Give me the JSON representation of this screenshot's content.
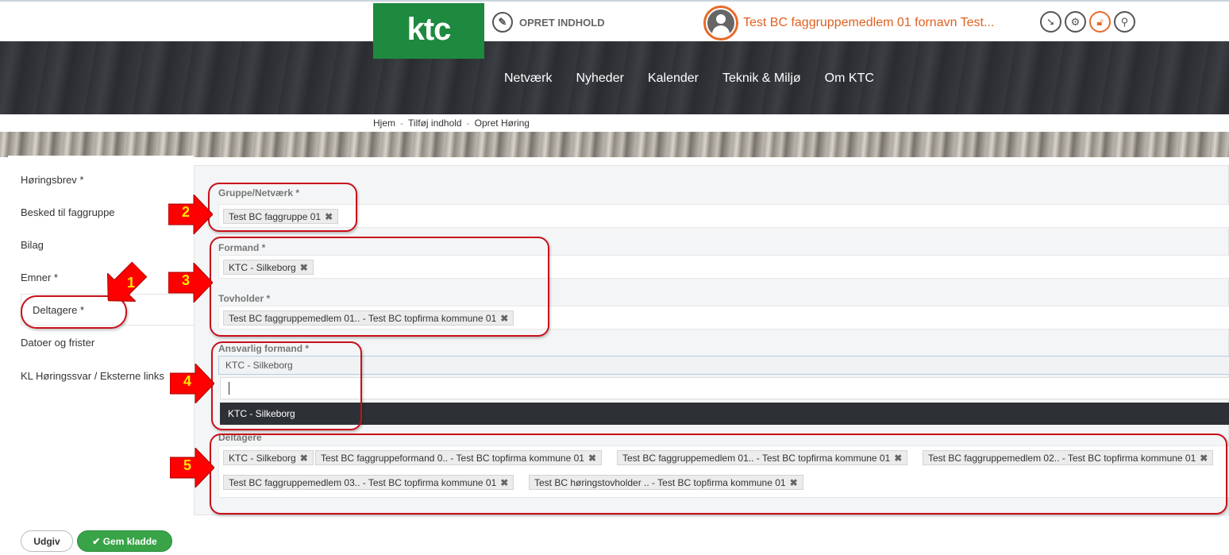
{
  "header": {
    "logo_text": "ktc",
    "create_label": "OPRET INDHOLD",
    "user_name": "Test BC faggruppemedlem 01 fornavn Test...",
    "icons": [
      "download-icon",
      "gear-icon",
      "lock-icon",
      "search-icon"
    ]
  },
  "nav": {
    "items": [
      "Netværk",
      "Nyheder",
      "Kalender",
      "Teknik & Miljø",
      "Om KTC"
    ]
  },
  "breadcrumb": {
    "items": [
      "Hjem",
      "Tilføj indhold",
      "Opret Høring"
    ],
    "separator": "-"
  },
  "sidebar": {
    "items": [
      {
        "label": "Høringsbrev *"
      },
      {
        "label": "Besked til faggruppe"
      },
      {
        "label": "Bilag"
      },
      {
        "label": "Emner *"
      },
      {
        "label": "Deltagere *"
      },
      {
        "label": "Datoer og frister"
      },
      {
        "label": "KL Høringssvar / Eksterne links"
      }
    ],
    "active_label": "Deltagere *"
  },
  "form": {
    "gruppe": {
      "label": "Gruppe/Netværk *",
      "tags": [
        "Test BC faggruppe 01"
      ]
    },
    "formand": {
      "label": "Formand *",
      "tags": [
        "KTC - Silkeborg"
      ]
    },
    "tovholder": {
      "label": "Tovholder *",
      "tags": [
        "Test BC faggruppemedlem 01.. - Test BC topfirma kommune 01"
      ]
    },
    "ansvarlig": {
      "label": "Ansvarlig formand *",
      "selected": "KTC - Silkeborg",
      "search_value": "",
      "options": [
        "KTC - Silkeborg"
      ]
    },
    "deltagere": {
      "label": "Deltagere",
      "tags": [
        "KTC - Silkeborg",
        "Test BC faggruppeformand 0.. - Test BC topfirma kommune 01",
        "Test BC faggruppemedlem 01.. - Test BC topfirma kommune 01",
        "Test BC faggruppemedlem 02.. - Test BC topfirma kommune 01",
        "Test BC faggruppemedlem 03.. - Test BC topfirma kommune 01",
        "Test BC høringstovholder .. - Test BC topfirma kommune 01"
      ]
    },
    "remove_glyph": "✖"
  },
  "buttons": {
    "publish": "Udgiv",
    "save_draft": "Gem kladde",
    "save_icon": "✔"
  },
  "annotations": [
    "1",
    "2",
    "3",
    "4",
    "5"
  ],
  "colors": {
    "brand_green": "#1e8a3f",
    "accent_orange": "#e66b2a",
    "annotation_red": "#c8101a",
    "annotation_arrow": "#ff0000",
    "annotation_number": "#ffe600"
  }
}
